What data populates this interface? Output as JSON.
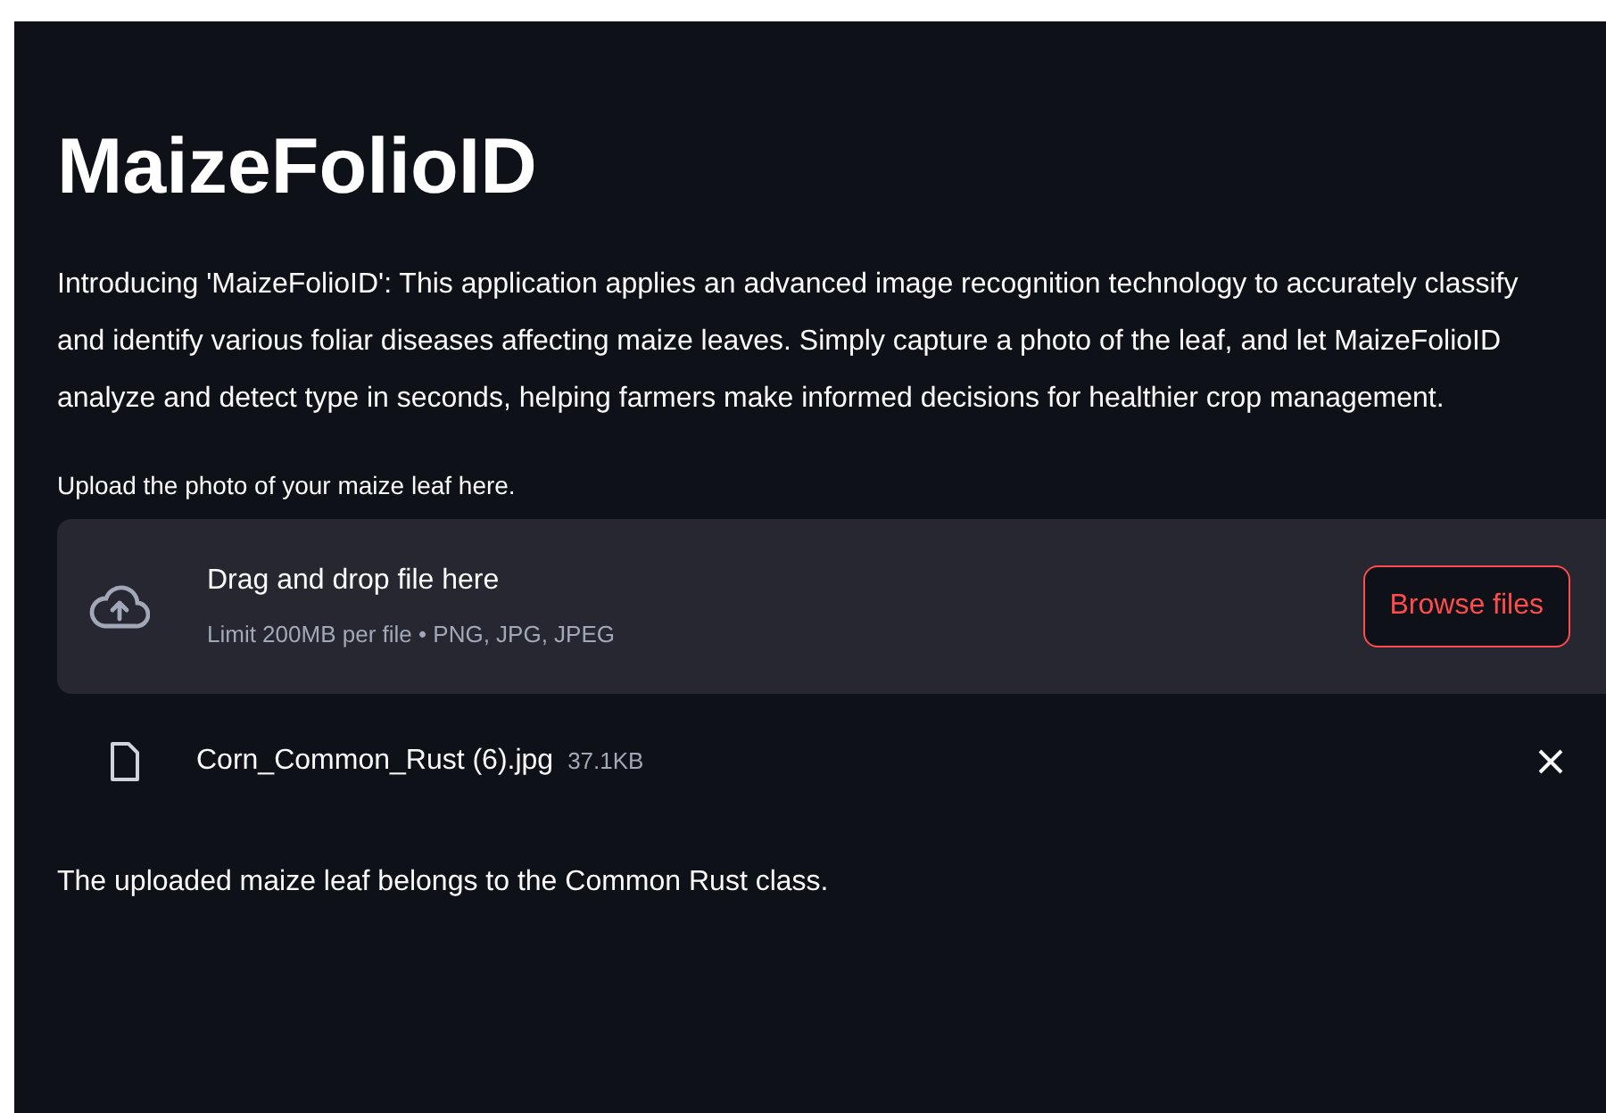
{
  "title": "MaizeFolioID",
  "intro": "Introducing 'MaizeFolioID': This application applies an advanced image recognition technology to accurately classify and identify various foliar diseases affecting maize leaves. Simply capture a photo of the leaf, and let MaizeFolioID analyze and detect type in seconds, helping farmers make informed decisions for healthier crop management.",
  "uploader": {
    "label": "Upload the photo of your maize leaf here.",
    "heading": "Drag and drop file here",
    "hint": "Limit 200MB per file • PNG, JPG, JPEG",
    "button": "Browse files"
  },
  "files": [
    {
      "name": "Corn_Common_Rust (6).jpg",
      "size": "37.1KB"
    }
  ],
  "result": "The uploaded maize leaf belongs to the Common Rust class."
}
